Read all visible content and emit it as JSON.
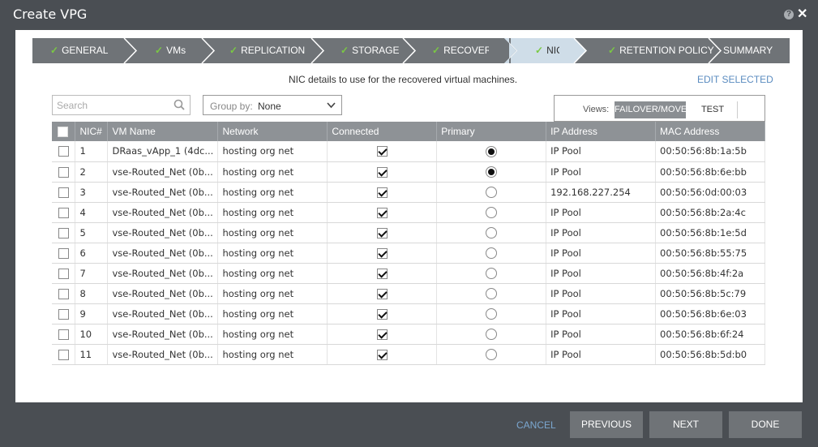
{
  "window": {
    "title": "Create VPG",
    "help_icon": "?",
    "close_icon": "✕"
  },
  "wizard": {
    "steps": [
      {
        "label": "GENERAL",
        "done": true
      },
      {
        "label": "VMs",
        "done": true
      },
      {
        "label": "REPLICATION",
        "done": true
      },
      {
        "label": "STORAGE",
        "done": true
      },
      {
        "label": "RECOVERY",
        "done": true
      },
      {
        "label": "NICs",
        "done": true,
        "active": true
      },
      {
        "label": "RETENTION POLICY",
        "done": true
      },
      {
        "label": "SUMMARY",
        "done": false
      }
    ],
    "check_mark": "✓"
  },
  "main": {
    "subtitle": "NIC details to use for the recovered virtual machines.",
    "edit_selected": "EDIT SELECTED",
    "search": {
      "placeholder": "Search"
    },
    "group_by": {
      "label": "Group by:",
      "value": "None"
    },
    "views": {
      "label": "Views:",
      "options": [
        "FAILOVER/MOVE",
        "TEST"
      ],
      "selected": "FAILOVER/MOVE"
    }
  },
  "table": {
    "columns": [
      "NIC#",
      "VM Name",
      "Network",
      "Connected",
      "Primary",
      "IP Address",
      "MAC Address"
    ],
    "rows": [
      {
        "nic": "1",
        "vm": "DRaas_vApp_1 (4dc...",
        "network": "hosting org net",
        "connected": true,
        "primary": true,
        "ip": "IP Pool",
        "mac": "00:50:56:8b:1a:5b"
      },
      {
        "nic": "2",
        "vm": "vse-Routed_Net (0b...",
        "network": "hosting org net",
        "connected": true,
        "primary": true,
        "ip": "IP Pool",
        "mac": "00:50:56:8b:6e:bb"
      },
      {
        "nic": "3",
        "vm": "vse-Routed_Net (0b...",
        "network": "hosting org net",
        "connected": true,
        "primary": false,
        "ip": "192.168.227.254",
        "mac": "00:50:56:0d:00:03"
      },
      {
        "nic": "4",
        "vm": "vse-Routed_Net (0b...",
        "network": "hosting org net",
        "connected": true,
        "primary": false,
        "ip": "IP Pool",
        "mac": "00:50:56:8b:2a:4c"
      },
      {
        "nic": "5",
        "vm": "vse-Routed_Net (0b...",
        "network": "hosting org net",
        "connected": true,
        "primary": false,
        "ip": "IP Pool",
        "mac": "00:50:56:8b:1e:5d"
      },
      {
        "nic": "6",
        "vm": "vse-Routed_Net (0b...",
        "network": "hosting org net",
        "connected": true,
        "primary": false,
        "ip": "IP Pool",
        "mac": "00:50:56:8b:55:75"
      },
      {
        "nic": "7",
        "vm": "vse-Routed_Net (0b...",
        "network": "hosting org net",
        "connected": true,
        "primary": false,
        "ip": "IP Pool",
        "mac": "00:50:56:8b:4f:2a"
      },
      {
        "nic": "8",
        "vm": "vse-Routed_Net (0b...",
        "network": "hosting org net",
        "connected": true,
        "primary": false,
        "ip": "IP Pool",
        "mac": "00:50:56:8b:5c:79"
      },
      {
        "nic": "9",
        "vm": "vse-Routed_Net (0b...",
        "network": "hosting org net",
        "connected": true,
        "primary": false,
        "ip": "IP Pool",
        "mac": "00:50:56:8b:6e:03"
      },
      {
        "nic": "10",
        "vm": "vse-Routed_Net (0b...",
        "network": "hosting org net",
        "connected": true,
        "primary": false,
        "ip": "IP Pool",
        "mac": "00:50:56:8b:6f:24"
      },
      {
        "nic": "11",
        "vm": "vse-Routed_Net (0b...",
        "network": "hosting org net",
        "connected": true,
        "primary": false,
        "ip": "IP Pool",
        "mac": "00:50:56:8b:5d:b0"
      }
    ]
  },
  "footer": {
    "cancel": "CANCEL",
    "previous": "PREVIOUS",
    "next": "NEXT",
    "done": "DONE"
  },
  "colors": {
    "accent_check": "#7ac943",
    "active_step": "#cfdde8",
    "step_bg": "#6f7377",
    "link": "#5b8cc0"
  }
}
